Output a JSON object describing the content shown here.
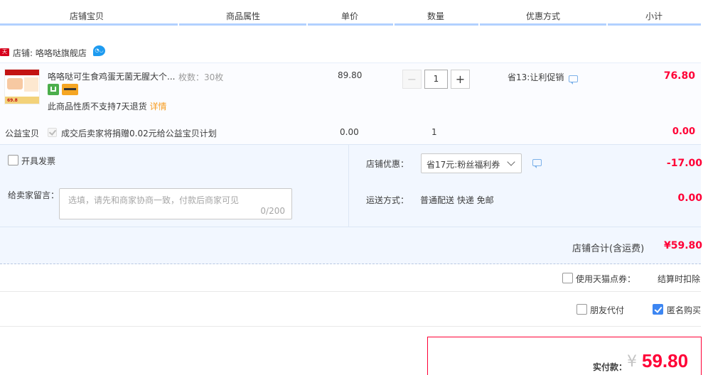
{
  "header": {
    "col_shop_item": "店铺宝贝",
    "col_attrs": "商品属性",
    "col_unit_price": "单价",
    "col_quantity": "数量",
    "col_discount": "优惠方式",
    "col_subtotal": "小计"
  },
  "shop": {
    "tag": "天猫",
    "label": "店铺: 咯咯哒旗舰店",
    "chat_icon": "wangwang-chat-icon"
  },
  "item": {
    "title": "咯咯哒可生食鸡蛋无菌无腥大个...",
    "sku": "枚数：30枚",
    "no_return": "此商品性质不支持7天退货",
    "detail_link": "详情",
    "unit_price": "89.80",
    "quantity": "1",
    "minus": "−",
    "plus": "+",
    "promo": "省13:让利促销",
    "subtotal": "76.80"
  },
  "charity": {
    "label": "公益宝贝",
    "text": "成交后卖家将捐赠0.02元给公益宝贝计划",
    "unit_price": "0.00",
    "quantity": "1",
    "subtotal": "0.00"
  },
  "options": {
    "invoice_label": "开具发票",
    "memo_label": "给卖家留言：",
    "memo_placeholder": "选填，请先和商家协商一致，付款后商家可见",
    "memo_count": "0/200",
    "shop_discount_label": "店铺优惠：",
    "shop_discount_selected": "省17元:粉丝福利券",
    "shop_discount_value": "-17.00",
    "shipping_label": "运送方式：",
    "shipping_value": "普通配送 快递 免邮",
    "shipping_price": "0.00"
  },
  "totals": {
    "shop_total_label": "店铺合计(含运费)",
    "shop_total_value": "¥59.80",
    "tmall_points_label": "使用天猫点券：",
    "settle_text": "结算时扣除",
    "friend_pay_label": "朋友代付",
    "anonymous_label": "匿名购买",
    "anonymous_checked": true,
    "pay_label": "实付款：",
    "pay_currency": "¥",
    "pay_amount": "59.80"
  },
  "colors": {
    "accent_red": "#ff0036",
    "header_bar": "#b2d1ff",
    "option_bg": "#f2f7ff",
    "checkbox_blue": "#3d86f2"
  }
}
